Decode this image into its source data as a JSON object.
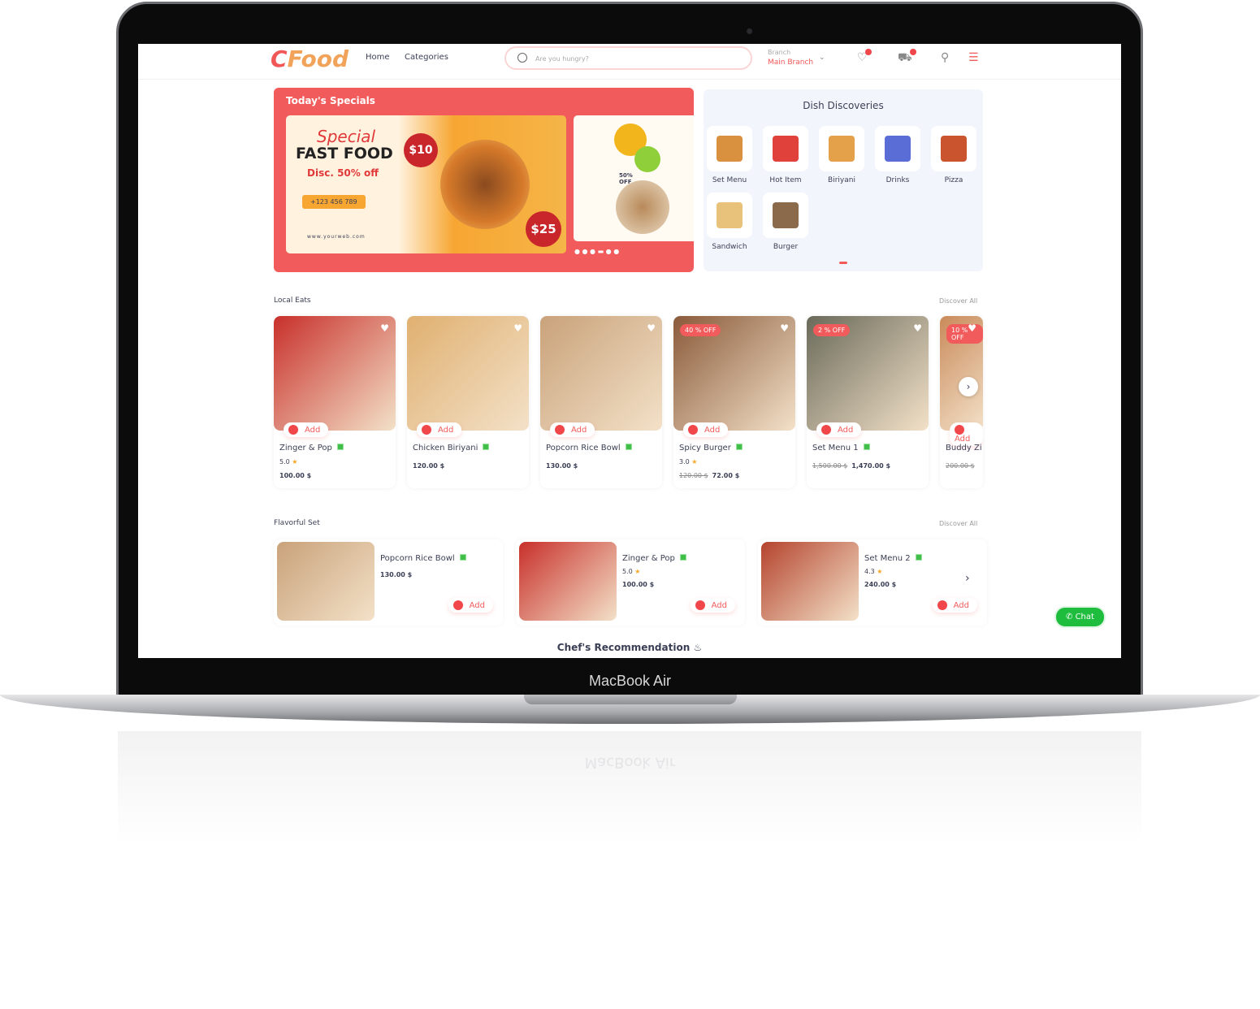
{
  "device": {
    "label": "MacBook Air"
  },
  "header": {
    "logo": "Food",
    "logo_initial": "C",
    "nav": [
      "Home",
      "Categories"
    ],
    "search_placeholder": "Are you hungry?",
    "branch_label": "Branch",
    "branch_value": "Main Branch"
  },
  "specials": {
    "title": "Today's Specials",
    "banner1": {
      "headline1": "Special",
      "headline2": "FAST FOOD",
      "discount": "Disc. 50% off",
      "price1": "$10",
      "price2": "$25",
      "website": "www.yourweb.com",
      "phone": "+123 456 789"
    },
    "banner2": {
      "discount": "50% OFF"
    }
  },
  "discoveries": {
    "title": "Dish Discoveries",
    "items": [
      {
        "label": "Set Menu",
        "color": "#d9903f"
      },
      {
        "label": "Hot Item",
        "color": "#e0413a"
      },
      {
        "label": "Biriyani",
        "color": "#e5a04a"
      },
      {
        "label": "Drinks",
        "color": "#5a6cd6"
      },
      {
        "label": "Pizza",
        "color": "#c9542e"
      },
      {
        "label": "Sandwich",
        "color": "#e8c27a"
      },
      {
        "label": "Burger",
        "color": "#8a6a4a"
      }
    ]
  },
  "local_eats": {
    "title": "Local Eats",
    "discover_all": "Discover All",
    "add_label": "Add",
    "items": [
      {
        "name": "Zinger & Pop",
        "rating": "5.0",
        "price": "100.00 $",
        "badge": "",
        "color": "#c8302b"
      },
      {
        "name": "Chicken Biriyani",
        "rating": "",
        "price": "120.00 $",
        "badge": "",
        "color": "#e0b070"
      },
      {
        "name": "Popcorn Rice Bowl",
        "rating": "",
        "price": "130.00 $",
        "badge": "",
        "color": "#c9a27a"
      },
      {
        "name": "Spicy Burger",
        "rating": "3.0",
        "old_price": "120.00 $",
        "price": "72.00 $",
        "badge": "40 % OFF",
        "color": "#8a5a3a"
      },
      {
        "name": "Set Menu 1",
        "rating": "",
        "old_price": "1,500.00 $",
        "price": "1,470.00 $",
        "badge": "2 % OFF",
        "color": "#6a6a5a"
      },
      {
        "name": "Buddy Zi",
        "rating": "",
        "old_price": "200.00 $",
        "price": "",
        "badge": "10 % OFF",
        "color": "#c98a5a"
      }
    ]
  },
  "flavorful_set": {
    "title": "Flavorful Set",
    "discover_all": "Discover All",
    "add_label": "Add",
    "items": [
      {
        "name": "Popcorn Rice Bowl",
        "rating": "",
        "price": "130.00 $",
        "color": "#c9a27a"
      },
      {
        "name": "Zinger & Pop",
        "rating": "5.0",
        "price": "100.00 $",
        "color": "#c8302b"
      },
      {
        "name": "Set Menu 2",
        "rating": "4.3",
        "price": "240.00 $",
        "color": "#b5442e"
      }
    ]
  },
  "chat_label": "Chat",
  "chef_title": "Chef's Recommendation",
  "colors": {
    "accent": "#f25b5b",
    "discoveries_bg": "#f2f6fc",
    "chat": "#1fbd3d"
  }
}
